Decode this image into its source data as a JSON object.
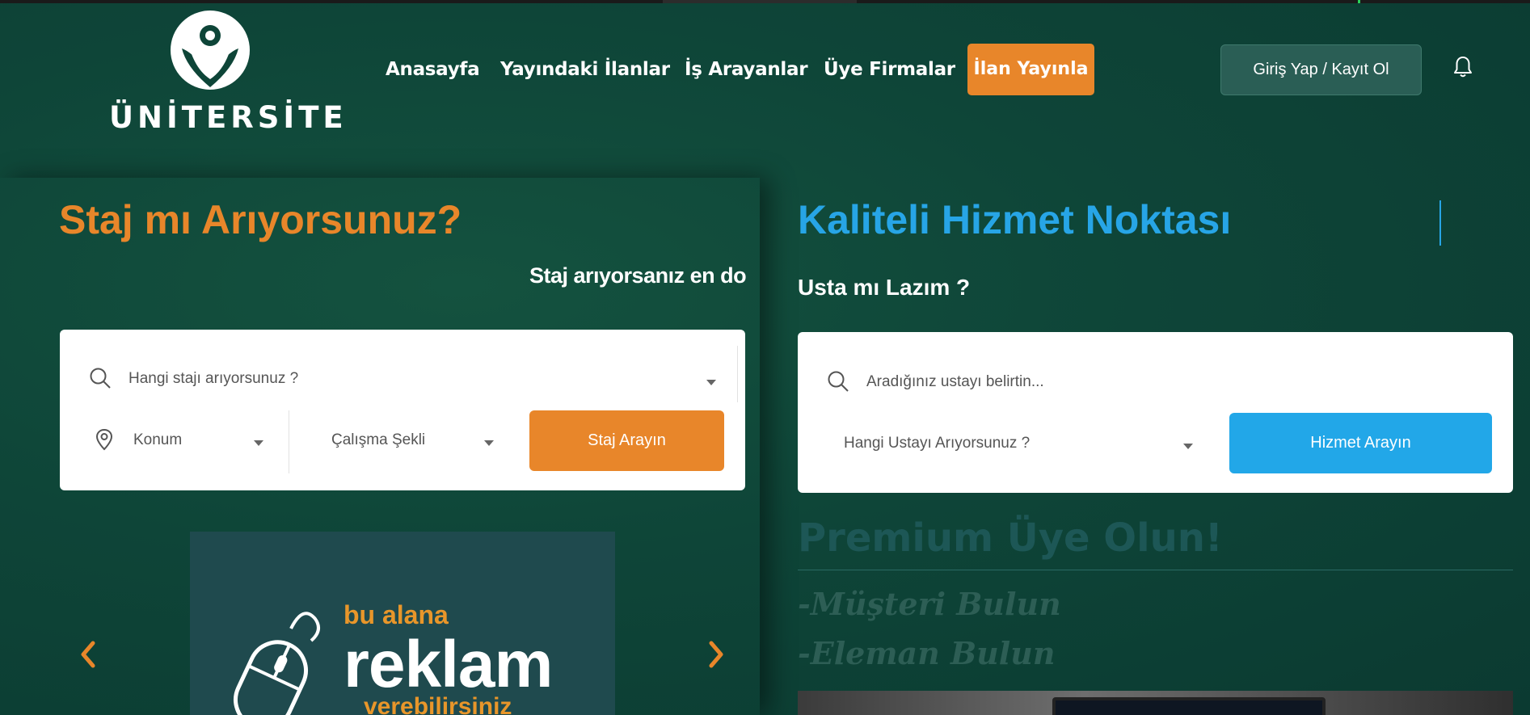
{
  "brand": {
    "name": "ÜNİTERSİTE"
  },
  "nav": {
    "items": [
      "Anasayfa",
      "Yayındaki İlanlar",
      "İş Arayanlar",
      "Üye Firmalar"
    ],
    "cta": "İlan Yayınla",
    "login": "Giriş Yap / Kayıt Ol",
    "notification_icon": "bell-icon"
  },
  "internship": {
    "title": "Staj mı Arıyorsunuz?",
    "marquee": "Staj arıyorsanız en doğ",
    "search_placeholder": "Hangi stajı arıyorsunuz ?",
    "location": "Konum",
    "work_type": "Çalışma Şekli",
    "button": "Staj Arayın"
  },
  "service": {
    "title": "Kaliteli Hizmet Noktası",
    "subtitle": "Usta mı Lazım ?",
    "search_placeholder": "Aradığınız ustayı belirtin...",
    "select": "Hangi Ustayı Arıyorsunuz ?",
    "button": "Hizmet Arayın"
  },
  "premium": {
    "title": "Premium Üye Olun!",
    "features": [
      "-Müşteri Bulun",
      "-Eleman Bulun"
    ]
  },
  "ad_banner": {
    "line1": "bu alana",
    "line2": "reklam",
    "line3": "verebilirsiniz"
  },
  "colors": {
    "background": "#0e4538",
    "accent_orange": "#e8862a",
    "accent_blue": "#22a7e8"
  }
}
